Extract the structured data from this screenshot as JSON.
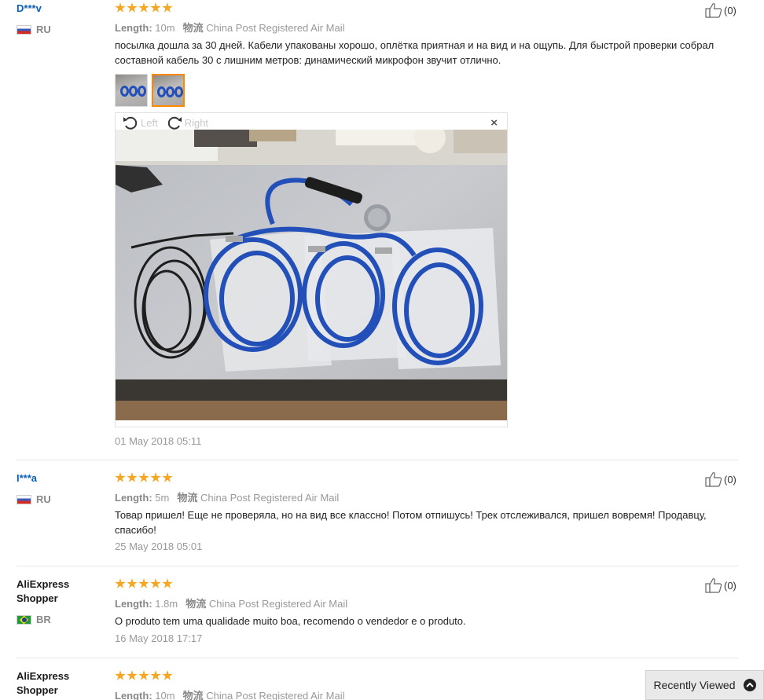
{
  "reviews": [
    {
      "user": "D***v",
      "country": "RU",
      "length_label": "Length:",
      "length_value": "10m",
      "shipping_label": "物流",
      "shipping_value": "China Post Registered Air Mail",
      "text": "посылка дошла за 30 дней. Кабели упакованы хорошо, оплётка приятная и на вид и на ощупь. Для быстрой проверки собрал составной кабель 30 с лишним метров: динамический микрофон звучит отлично.",
      "date": "01 May 2018 05:11",
      "helpful": "(0)"
    },
    {
      "user": "I***a",
      "country": "RU",
      "length_label": "Length:",
      "length_value": "5m",
      "shipping_label": "物流",
      "shipping_value": "China Post Registered Air Mail",
      "text": "Товар пришел! Еще не проверяла, но на вид все классно! Потом отпишусь! Трек отслеживался, пришел вовремя! Продавцу, спасибо!",
      "date": "25 May 2018 05:01",
      "helpful": "(0)"
    },
    {
      "user": "AliExpress Shopper",
      "country": "BR",
      "length_label": "Length:",
      "length_value": "1.8m",
      "shipping_label": "物流",
      "shipping_value": "China Post Registered Air Mail",
      "text": "O produto tem uma qualidade muito boa, recomendo o vendedor e o produto.",
      "date": "16 May 2018 17:17",
      "helpful": "(0)"
    },
    {
      "user": "AliExpress Shopper",
      "length_label": "Length:",
      "length_value": "10m",
      "shipping_label": "物流",
      "shipping_value": "China Post Registered Air Mail"
    }
  ],
  "viewer": {
    "rotate_left": "Left",
    "rotate_right": "Right",
    "close": "×"
  },
  "recently_viewed": "Recently Viewed",
  "colors": {
    "star": "#f5a623",
    "username_link": "#0a5fb4",
    "active_thumb_border": "#ff8a00",
    "cable_blue": "#2250b8"
  }
}
